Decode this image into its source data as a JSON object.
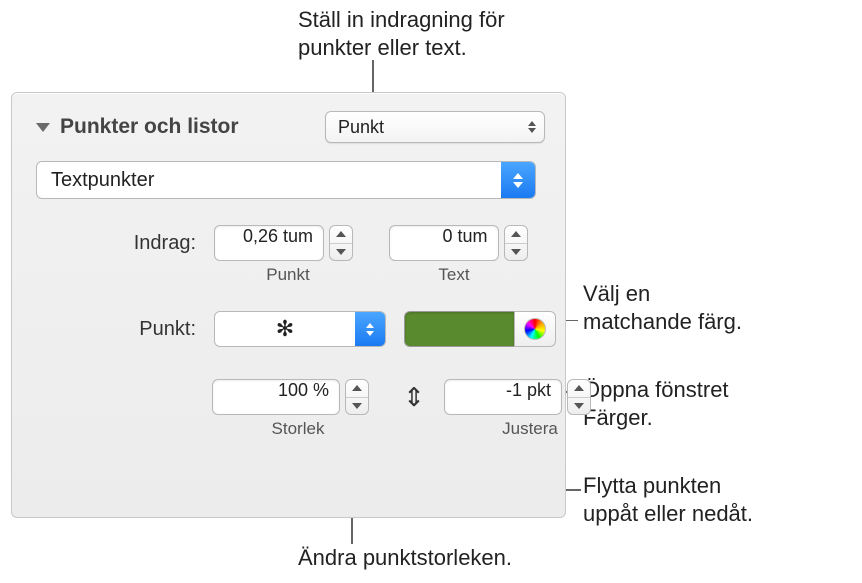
{
  "callouts": {
    "top": "Ställ in indragning för\npunkter eller text.",
    "color_swatch": "Välj en\nmatchande färg.",
    "color_wheel": "Öppna fönstret\nFärger.",
    "adjust": "Flytta punkten\nuppåt eller nedåt.",
    "size": "Ändra punktstorleken."
  },
  "section": {
    "title": "Punkter och listor",
    "type_dropdown": "Punkt",
    "style_dropdown": "Textpunkter"
  },
  "indent": {
    "label": "Indrag:",
    "bullet_value": "0,26 tum",
    "bullet_sublabel": "Punkt",
    "text_value": "0 tum",
    "text_sublabel": "Text"
  },
  "bullet": {
    "label": "Punkt:",
    "symbol": "✻",
    "swatch_color": "#5a8a2e"
  },
  "size": {
    "value": "100 %",
    "sublabel": "Storlek"
  },
  "adjust": {
    "value": "-1 pkt",
    "sublabel": "Justera"
  }
}
